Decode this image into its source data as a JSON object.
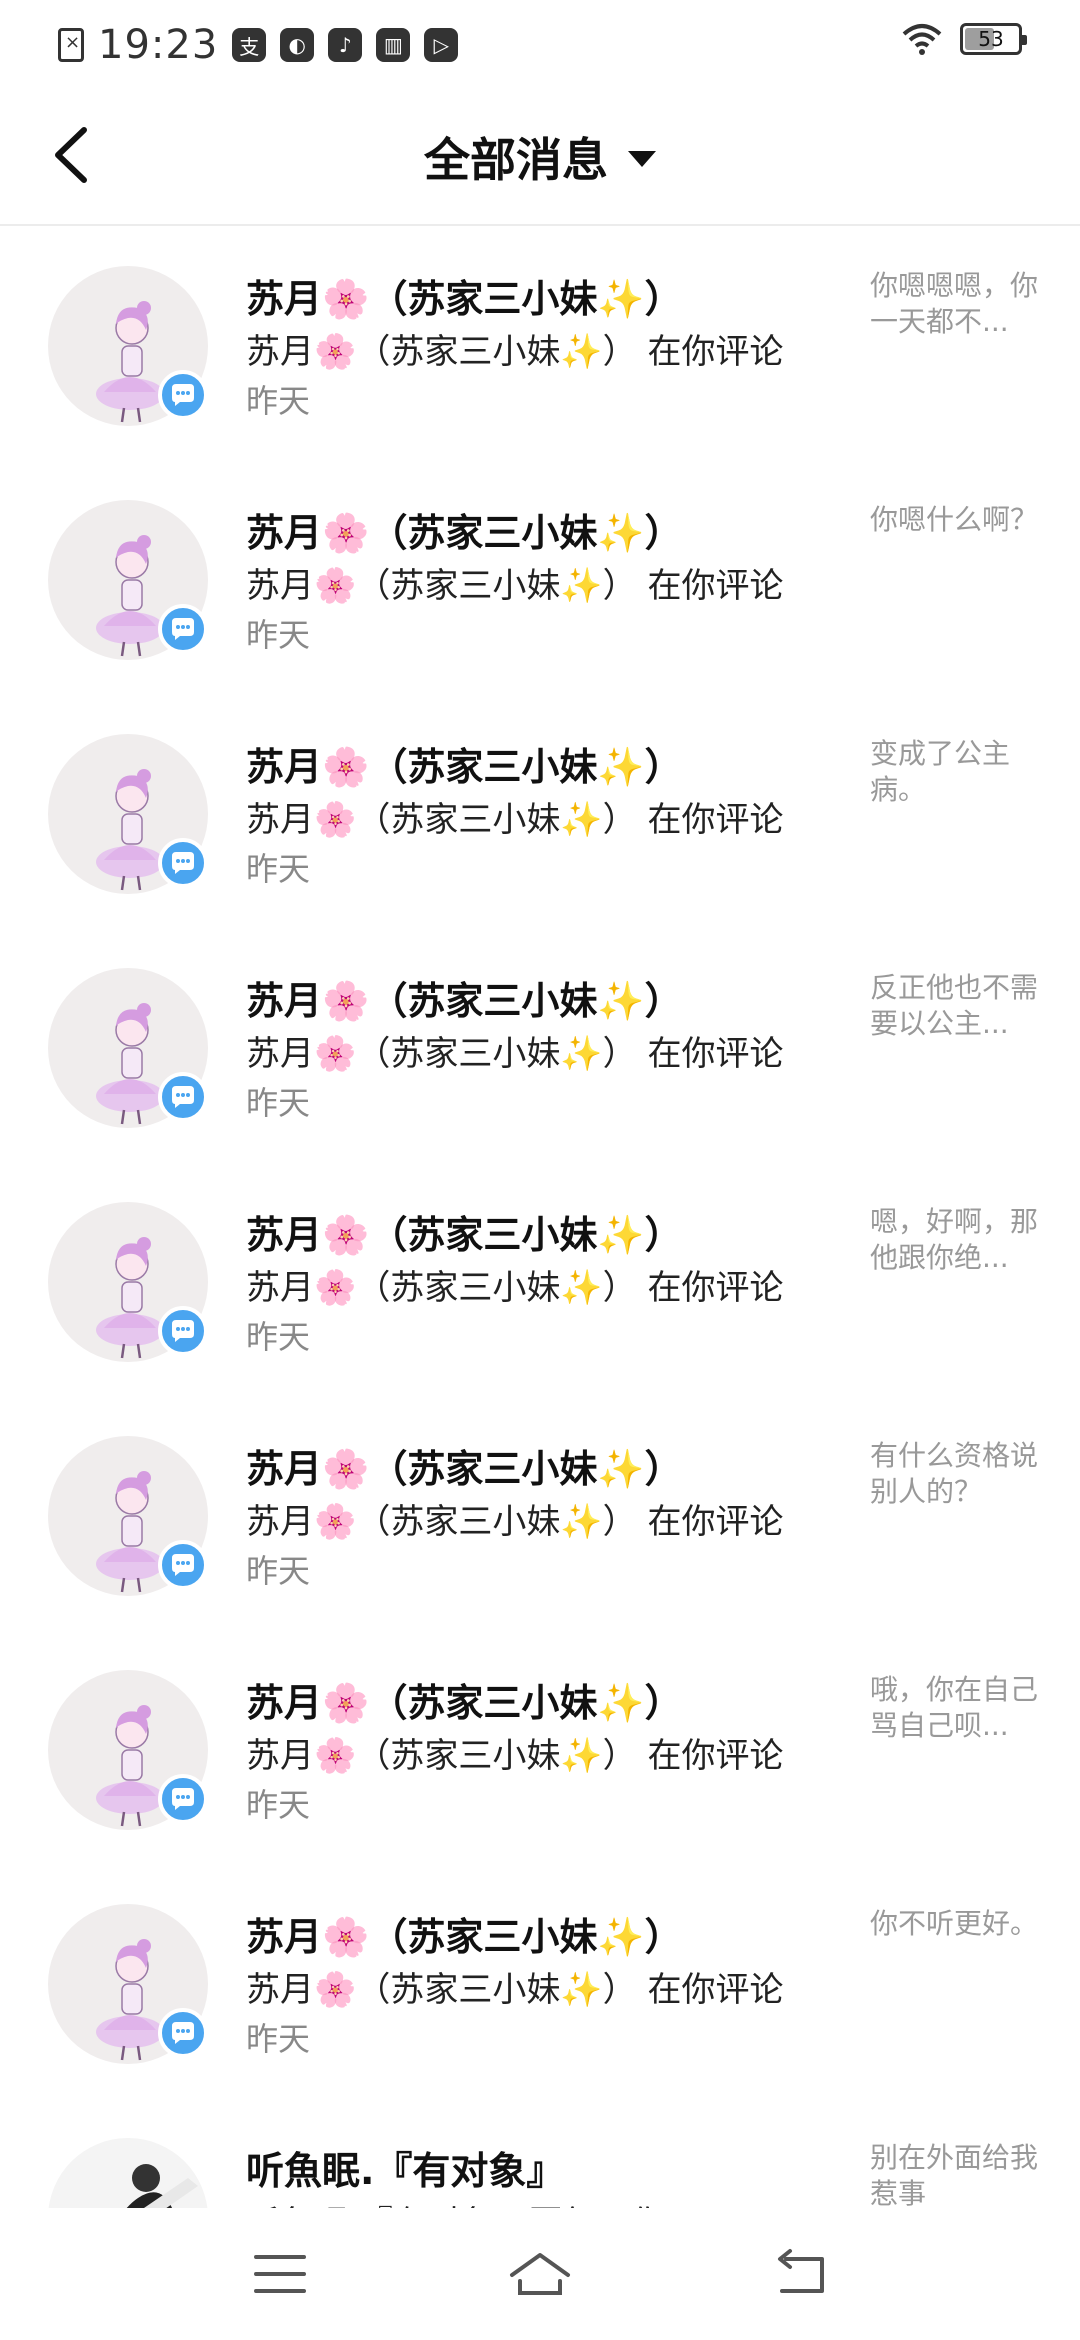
{
  "status_bar": {
    "time": "19:23",
    "apps": [
      "支",
      "◐",
      "♪",
      "▥",
      "▷"
    ],
    "battery": "53",
    "battery_level_percent": 53
  },
  "header": {
    "title": "全部消息"
  },
  "messages": [
    {
      "name": "苏月🌸（苏家三小妹✨）",
      "desc": "苏月🌸（苏家三小妹✨） 在你评论",
      "time": "昨天",
      "preview": "你嗯嗯嗯，你一天都不..."
    },
    {
      "name": "苏月🌸（苏家三小妹✨）",
      "desc": "苏月🌸（苏家三小妹✨） 在你评论",
      "time": "昨天",
      "preview": "你嗯什么啊？"
    },
    {
      "name": "苏月🌸（苏家三小妹✨）",
      "desc": "苏月🌸（苏家三小妹✨） 在你评论",
      "time": "昨天",
      "preview": "变成了公主病。"
    },
    {
      "name": "苏月🌸（苏家三小妹✨）",
      "desc": "苏月🌸（苏家三小妹✨） 在你评论",
      "time": "昨天",
      "preview": "反正他也不需要以公主..."
    },
    {
      "name": "苏月🌸（苏家三小妹✨）",
      "desc": "苏月🌸（苏家三小妹✨） 在你评论",
      "time": "昨天",
      "preview": "嗯，好啊，那他跟你绝..."
    },
    {
      "name": "苏月🌸（苏家三小妹✨）",
      "desc": "苏月🌸（苏家三小妹✨） 在你评论",
      "time": "昨天",
      "preview": "有什么资格说别人的？"
    },
    {
      "name": "苏月🌸（苏家三小妹✨）",
      "desc": "苏月🌸（苏家三小妹✨） 在你评论",
      "time": "昨天",
      "preview": "哦，你在自己骂自己呗..."
    },
    {
      "name": "苏月🌸（苏家三小妹✨）",
      "desc": "苏月🌸（苏家三小妹✨） 在你评论",
      "time": "昨天",
      "preview": "你不听更好。"
    }
  ],
  "last_message": {
    "name": "听魚眠.『有对象』",
    "desc": "听魚眠.『有对象』回复了你",
    "preview": "别在外面给我惹事"
  },
  "colors": {
    "badge": "#4aa5f0",
    "secondary_text": "#888888",
    "preview_text": "#999999"
  }
}
